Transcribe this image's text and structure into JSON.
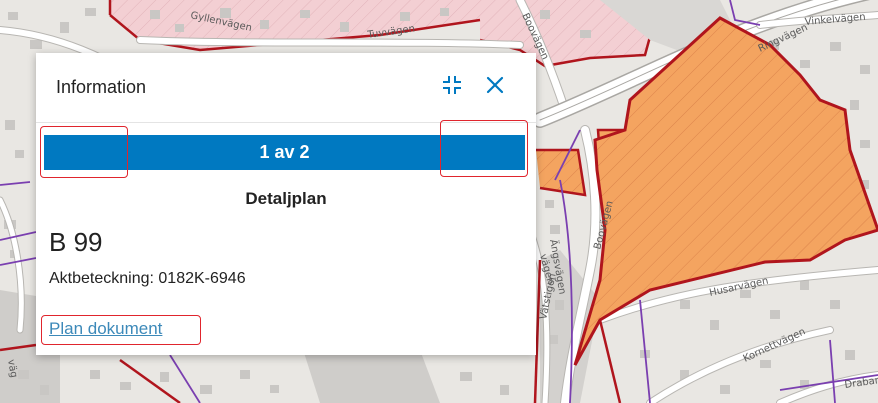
{
  "map": {
    "street_labels": [
      "Tuvvägen",
      "Gyllenvägen",
      "Boovägen",
      "Vinkelvägen",
      "Ringvägen",
      "Boovägen",
      "Husarvägen",
      "Kornettvägen",
      "Drabantvägen",
      "Vätstigen",
      "Ängsvägen",
      "vägen",
      "väg"
    ],
    "colors": {
      "base": "#e9e7e3",
      "building": "#c9c7c4",
      "road": "#ffffff",
      "road_edge": "#b8b6b2",
      "plan_fill": "#f4a460",
      "plan_border": "#b0151d",
      "pink_zone": "#f3cfd3",
      "purple_line": "#7a3fb0"
    }
  },
  "popup": {
    "title": "Information",
    "collapse_icon": "collapse-arrows-icon",
    "close_icon": "close-icon",
    "pager_label": "1 av 2",
    "section_title": "Detaljplan",
    "plan_name": "B 99",
    "aktbeteckning": "Aktbeteckning: 0182K-6946",
    "document_link": "Plan dokument",
    "colors": {
      "accent": "#0079c1",
      "link": "#3c89b9",
      "highlight_outline": "#e0252d"
    }
  }
}
